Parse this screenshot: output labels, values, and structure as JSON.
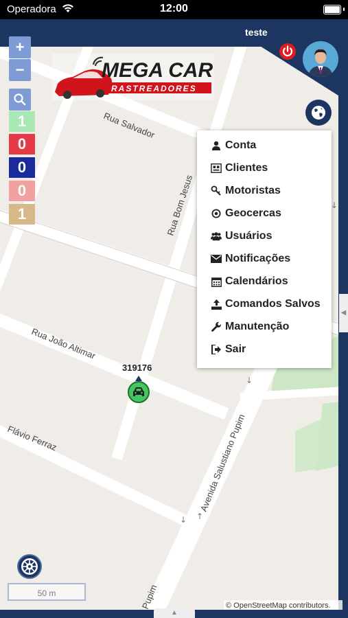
{
  "status_bar": {
    "carrier": "Operadora",
    "time": "12:00"
  },
  "header": {
    "user_name": "teste"
  },
  "map_controls": {
    "zoom_in": "+",
    "zoom_out": "−"
  },
  "counters": [
    {
      "value": "1",
      "color": "#a9e8b4"
    },
    {
      "value": "0",
      "color": "#e63946"
    },
    {
      "value": "0",
      "color": "#1a2b9c"
    },
    {
      "value": "0",
      "color": "#f0a1a1"
    },
    {
      "value": "1",
      "color": "#d7b888"
    }
  ],
  "logo": {
    "brand": "MEGA CAR",
    "tagline": "RASTREADORES"
  },
  "streets": {
    "rua_salvador": "Rua Salvador",
    "rua_bom_jesus": "Rua Bom Jesus",
    "rua_joao_altimar": "Rua João Altimar",
    "rua_flavio_ferraz": "Flávio Ferraz",
    "avenida_salustiano_pupim": "Avenida Salustiano Pupim",
    "pupim": "Pupim"
  },
  "menu": {
    "items": [
      {
        "label": "Conta",
        "icon": "user-icon"
      },
      {
        "label": "Clientes",
        "icon": "clients-icon"
      },
      {
        "label": "Motoristas",
        "icon": "key-icon"
      },
      {
        "label": "Geocercas",
        "icon": "target-icon"
      },
      {
        "label": "Usuários",
        "icon": "users-icon"
      },
      {
        "label": "Notificações",
        "icon": "envelope-icon"
      },
      {
        "label": "Calendários",
        "icon": "calendar-icon"
      },
      {
        "label": "Comandos Salvos",
        "icon": "upload-icon"
      },
      {
        "label": "Manutenção",
        "icon": "wrench-icon"
      },
      {
        "label": "Sair",
        "icon": "sign-out-icon"
      }
    ]
  },
  "vehicle": {
    "label": "319176",
    "color": "#43c660"
  },
  "scale": {
    "label": "50 m"
  },
  "attribution": "© OpenStreetMap contributors.",
  "colors": {
    "brand_blue": "#1d3561",
    "accent_red": "#e21b23",
    "park_green": "#cde7c6"
  }
}
